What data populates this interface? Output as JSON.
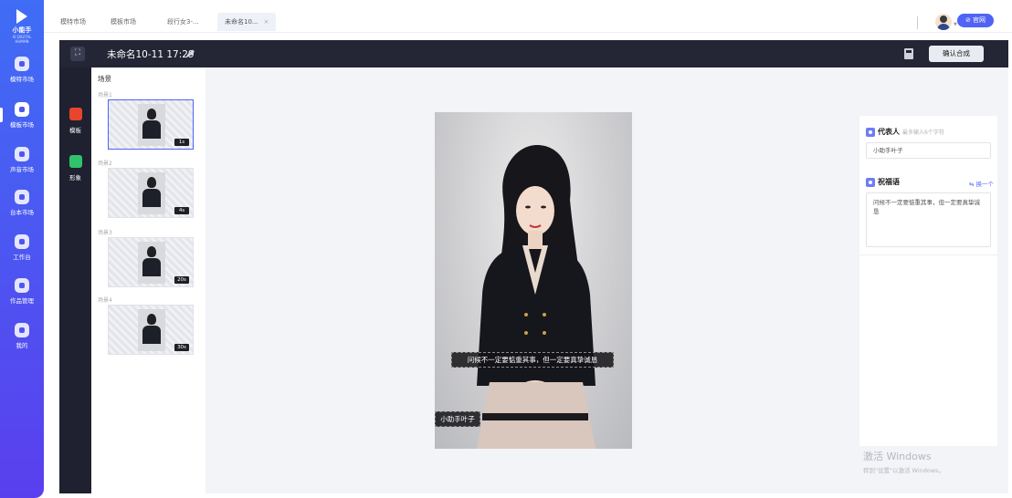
{
  "app": {
    "name": "小能手",
    "subtitle": "AI DIGITAL HUMAN",
    "nav": [
      {
        "label": "模特市场",
        "icon": "user-icon"
      },
      {
        "label": "模板市场",
        "icon": "template-icon",
        "active": true
      },
      {
        "label": "声音市场",
        "icon": "voice-icon"
      },
      {
        "label": "台本市场",
        "icon": "script-icon"
      },
      {
        "label": "工作台",
        "icon": "workbench-icon"
      },
      {
        "label": "作品管理",
        "icon": "works-icon"
      },
      {
        "label": "我的",
        "icon": "profile-icon"
      }
    ]
  },
  "tabs": [
    {
      "label": "模特市场"
    },
    {
      "label": "模板市场"
    },
    {
      "label": "段行女3-..."
    },
    {
      "label": "未命名10...",
      "active": true,
      "close": "×"
    }
  ],
  "header": {
    "official_button": "⊘ 官网"
  },
  "editor": {
    "expand_icon": "⛶",
    "project_title": "未命名10-11 17:29",
    "confirm_button": "确认合成"
  },
  "rail": [
    {
      "label": "模板",
      "icon": "template-icon",
      "color": "#e8452c"
    },
    {
      "label": "形象",
      "icon": "avatar-icon",
      "color": "#2fc46b"
    }
  ],
  "scenes": {
    "title": "场景",
    "items": [
      {
        "label": "场景1",
        "duration": "1s",
        "selected": true
      },
      {
        "label": "场景2",
        "duration": "4s"
      },
      {
        "label": "场景3",
        "duration": "20s"
      },
      {
        "label": "场景4",
        "duration": "30s"
      }
    ]
  },
  "preview": {
    "subtitle": "问候不一定要惦重其事，但一定要真挚诚恳",
    "name_tag": "小助手叶子"
  },
  "properties": {
    "representative": {
      "title": "代表人",
      "hint": "最多输入6个字符",
      "value": "小助手叶子"
    },
    "greeting": {
      "title": "祝福语",
      "swap": "⇆ 换一个",
      "value": "问候不一定要惦重其事，但一定要真挚诚恳"
    }
  },
  "watermark": {
    "line1": "激活 Windows",
    "line2": "转到\"设置\"以激活 Windows。"
  },
  "colors": {
    "accent": "#4f63f5",
    "toolbar": "#242635",
    "sidebar_top": "#3f6df5",
    "sidebar_bottom": "#5a3fee"
  }
}
